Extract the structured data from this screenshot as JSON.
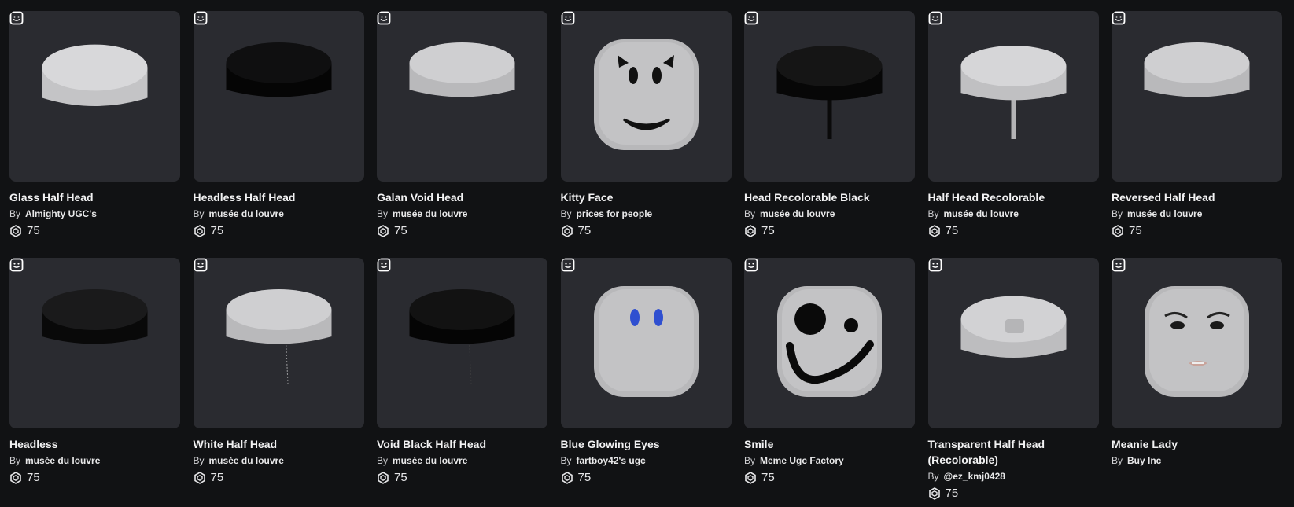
{
  "items": [
    {
      "name": "Glass Half Head",
      "by": "By",
      "creator": "Almighty UGC's",
      "price": "75",
      "thumb": "half-light"
    },
    {
      "name": "Headless Half Head",
      "by": "By",
      "creator": "musée du louvre",
      "price": "75",
      "thumb": "half-black"
    },
    {
      "name": "Galan Void Head",
      "by": "By",
      "creator": "musée du louvre",
      "price": "75",
      "thumb": "half-gray"
    },
    {
      "name": "Kitty Face",
      "by": "By",
      "creator": "prices for people",
      "price": "75",
      "thumb": "kitty-face"
    },
    {
      "name": "Head Recolorable Black",
      "by": "By",
      "creator": "musée du louvre",
      "price": "75",
      "thumb": "half-black-stick"
    },
    {
      "name": "Half Head Recolorable",
      "by": "By",
      "creator": "musée du louvre",
      "price": "75",
      "thumb": "half-gray-stick"
    },
    {
      "name": "Reversed Half Head",
      "by": "By",
      "creator": "musée du louvre",
      "price": "75",
      "thumb": "half-gray"
    },
    {
      "name": "Headless",
      "by": "By",
      "creator": "musée du louvre",
      "price": "75",
      "thumb": "half-black-wide"
    },
    {
      "name": "White Half Head",
      "by": "By",
      "creator": "musée du louvre",
      "price": "75",
      "thumb": "half-gray-thin"
    },
    {
      "name": "Void Black Half Head",
      "by": "By",
      "creator": "musée du louvre",
      "price": "75",
      "thumb": "half-black-thin"
    },
    {
      "name": "Blue Glowing Eyes",
      "by": "By",
      "creator": "fartboy42's ugc",
      "price": "75",
      "thumb": "blue-eyes"
    },
    {
      "name": "Smile",
      "by": "By",
      "creator": "Meme Ugc Factory",
      "price": "75",
      "thumb": "smile-face"
    },
    {
      "name": "Transparent Half Head (Recolorable)",
      "by": "By",
      "creator": "@ez_kmj0428",
      "price": "75",
      "thumb": "half-transparent"
    },
    {
      "name": "Meanie Lady",
      "by": "By",
      "creator": "Buy Inc",
      "price": "",
      "thumb": "lady-face"
    }
  ],
  "colors": {
    "background": "#111214",
    "card": "#2a2b30",
    "text": "#ffffff"
  },
  "icons": {
    "badge": "head-category-icon",
    "currency": "robux-icon"
  }
}
